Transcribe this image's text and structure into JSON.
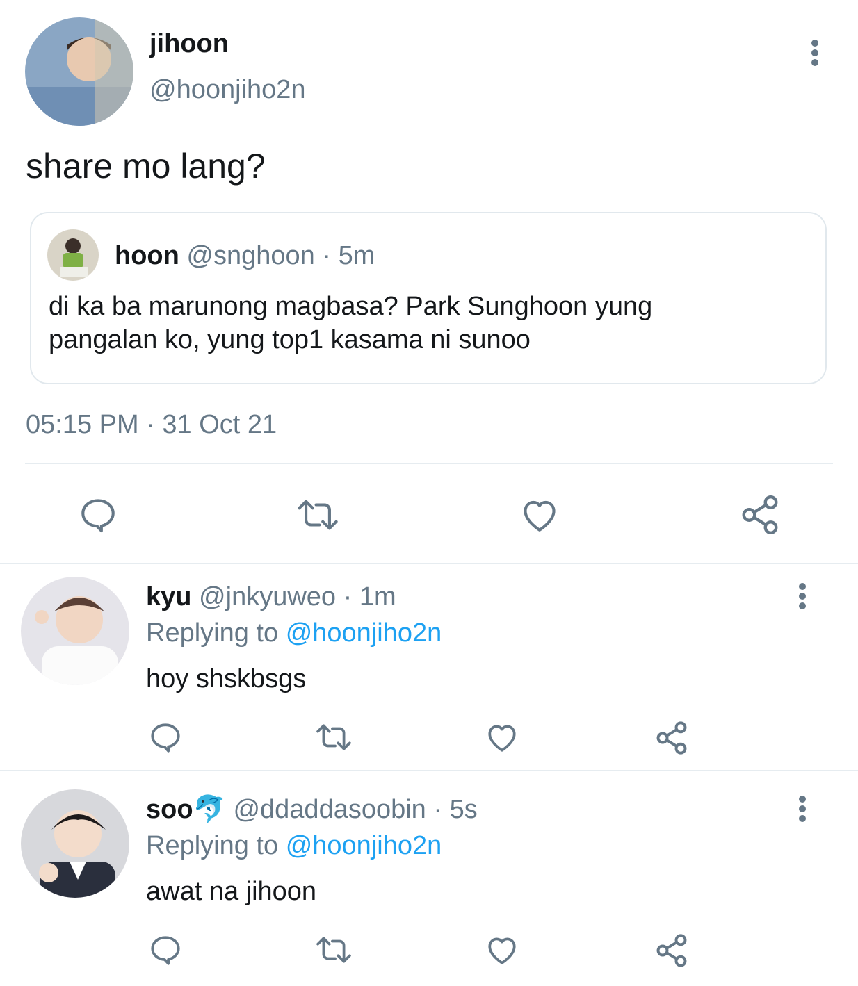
{
  "main_tweet": {
    "display_name": "jihoon",
    "handle": "@hoonjiho2n",
    "text": "share mo lang?",
    "timestamp": "05:15 PM · 31 Oct 21",
    "quoted": {
      "display_name": "hoon",
      "handle": "@snghoon",
      "dot": "·",
      "time": "5m",
      "text_line1": "di ka ba marunong magbasa? Park Sunghoon yung",
      "text_line2": "pangalan ko, yung top1 kasama ni sunoo"
    }
  },
  "replies": [
    {
      "display_name": "kyu",
      "emoji": "",
      "handle": "@jnkyuweo",
      "dot": "·",
      "time": "1m",
      "replying_prefix": "Replying to",
      "replying_handle": "@hoonjiho2n",
      "text": "hoy shskbsgs"
    },
    {
      "display_name": "soo",
      "emoji": "🐬",
      "handle": "@ddaddasoobin",
      "dot": "·",
      "time": "5s",
      "replying_prefix": "Replying to",
      "replying_handle": "@hoonjiho2n",
      "text": "awat na jihoon"
    }
  ],
  "colors": {
    "text": "#14171a",
    "muted": "#657786",
    "link": "#1da1f2",
    "divider": "#e6ecf0"
  },
  "icons": [
    "reply-icon",
    "retweet-icon",
    "like-icon",
    "share-icon",
    "more-options-icon"
  ]
}
